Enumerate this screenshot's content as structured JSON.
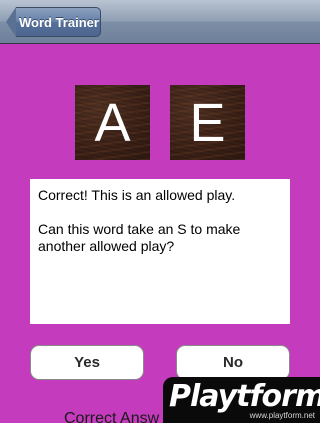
{
  "navbar": {
    "back_label": "Word Trainer"
  },
  "tiles": [
    {
      "letter": "A"
    },
    {
      "letter": "E"
    }
  ],
  "message": {
    "line1": "Correct! This is an allowed play.",
    "line2": "Can this word take an S to make another allowed play?"
  },
  "buttons": {
    "yes_label": "Yes",
    "no_label": "No"
  },
  "footer": {
    "correct_answers_text": "Correct Answ"
  },
  "watermark": {
    "brand": "Playtform",
    "url": "www.playtform.net"
  },
  "colors": {
    "background": "#c53bbd",
    "tile": "#3a2016",
    "navbar": "#8e9eb3"
  }
}
